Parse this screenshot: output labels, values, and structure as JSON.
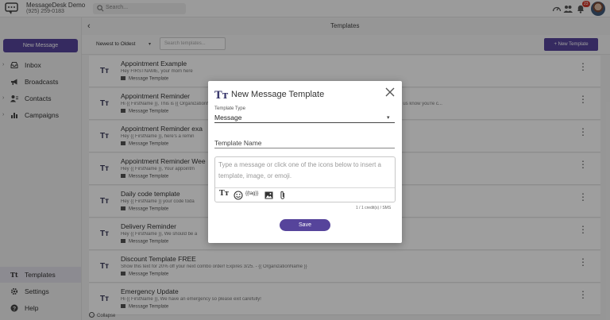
{
  "header": {
    "brand_name": "MessageDesk Demo",
    "brand_phone": "(925) 259-0183",
    "search_placeholder": "Search...",
    "notification_count": "23"
  },
  "sidebar": {
    "new_message_label": "New Message",
    "top_items": [
      {
        "label": "Inbox",
        "icon": "inbox-icon"
      },
      {
        "label": "Broadcasts",
        "icon": "megaphone-icon"
      },
      {
        "label": "Contacts",
        "icon": "contacts-icon"
      },
      {
        "label": "Campaigns",
        "icon": "campaigns-icon"
      }
    ],
    "bottom_items": [
      {
        "label": "Templates",
        "icon": "templates-icon",
        "active": true
      },
      {
        "label": "Settings",
        "icon": "gear-icon"
      },
      {
        "label": "Help",
        "icon": "help-icon"
      }
    ]
  },
  "main": {
    "title": "Templates",
    "sort_label": "Newest to Oldest",
    "search_placeholder": "Search templates...",
    "new_template_label": "+ New Template",
    "collapse_label": "Collapse",
    "templates": [
      {
        "name": "Appointment Example",
        "preview": "Hey FIRSTNAME, your mom here",
        "type": "Message Template"
      },
      {
        "name": "Appointment Reminder",
        "preview": "Hi {{ FirstName }}, This is {{ OrganizationName }} reminding you about your upcoming Appointment. Please text back CONFIRM to let us know you're c...",
        "type": "Message Template"
      },
      {
        "name": "Appointment Reminder exa",
        "preview": "Hey {{ FirstName }}, here's a remin",
        "type": "Message Template"
      },
      {
        "name": "Appointment Reminder Wee",
        "preview": "Hey {{ FirstName }}, Your appointm",
        "type": "Message Template"
      },
      {
        "name": "Daily code template",
        "preview": "Hey {{ FirstName }} your code toda",
        "type": "Message Template"
      },
      {
        "name": "Delivery Reminder",
        "preview": "Hey {{ FirstName }}, We should be a",
        "type": "Message Template"
      },
      {
        "name": "Discount Template FREE",
        "preview": "Show this text for 20% off your next combo order! Expires 3/25. - {{ OrganizationName }}",
        "type": "Message Template"
      },
      {
        "name": "Emergency Update",
        "preview": "Hi {{ FirstName }}, We have an emergency so please exit carefully!",
        "type": "Message Template"
      }
    ]
  },
  "modal": {
    "title": "New Message Template",
    "template_type_label": "Template Type",
    "template_type_value": "Message",
    "template_name_placeholder": "Template Name",
    "message_placeholder": "Type a message or click one of the icons below to insert a template, image, or emoji.",
    "tag_label": "{{tag}}",
    "credits_text": "1 / 1 credit(s) / SMS",
    "save_label": "Save"
  },
  "colors": {
    "accent": "#56449b",
    "title_icon": "#3b3a6e",
    "badge": "#d0392b"
  }
}
